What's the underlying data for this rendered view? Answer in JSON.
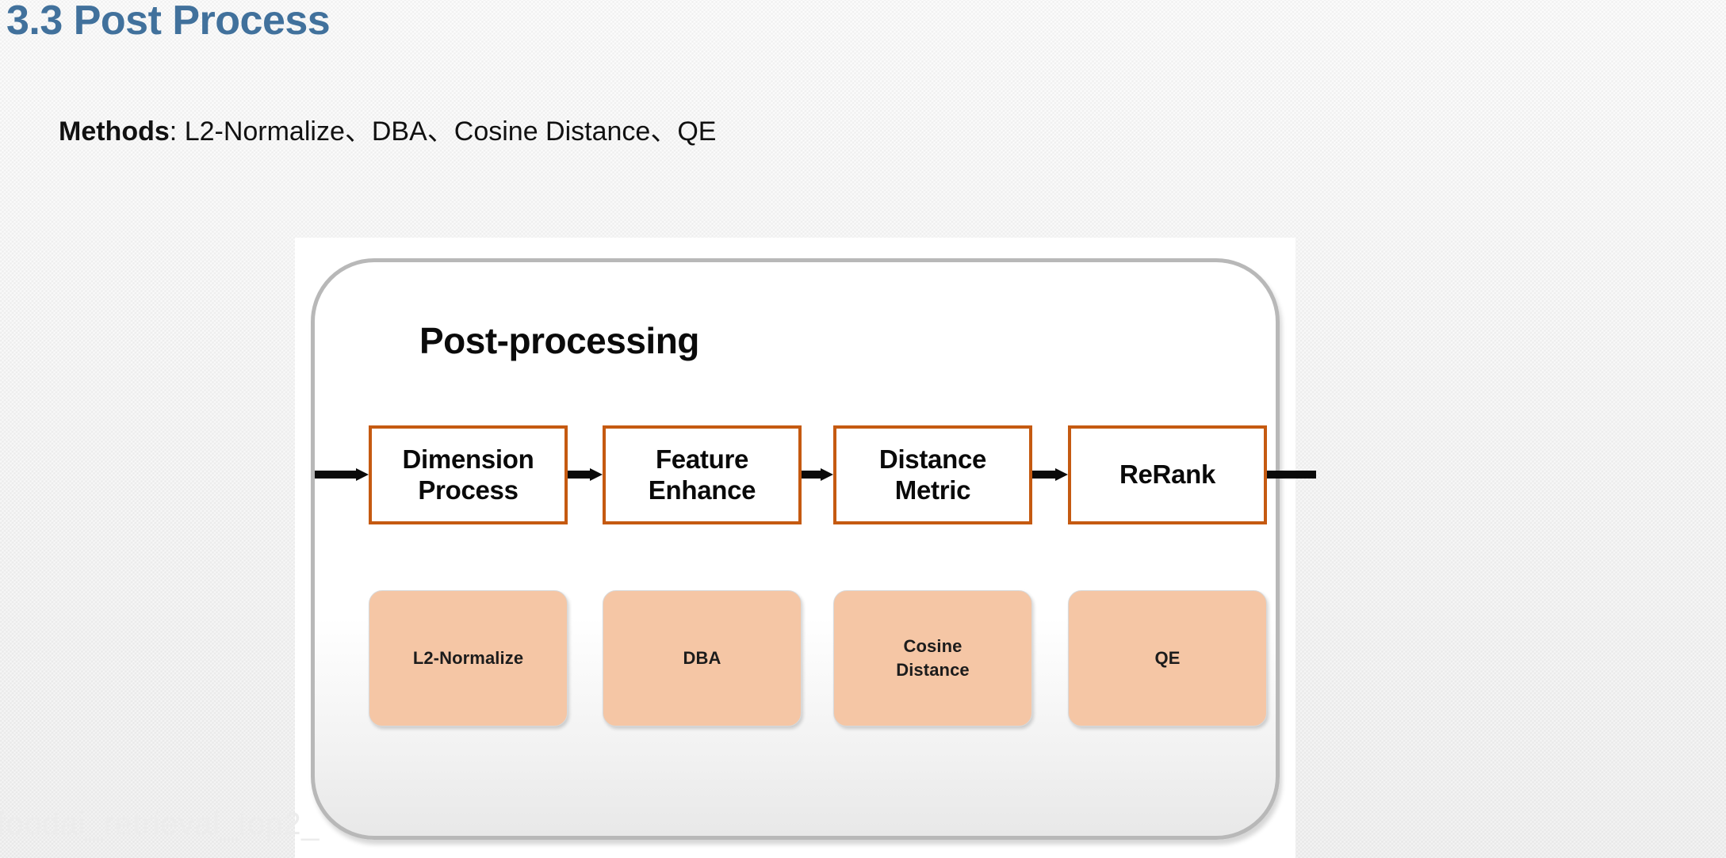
{
  "slide": {
    "title": "3.3 Post Process",
    "title_color": "#41719C",
    "background_color": "#fafafa",
    "watermark": "foodai_retrieval_top2_"
  },
  "methods_line": {
    "label": "Methods",
    "separator": ": ",
    "value": "L2-Normalize、DBA、Cosine Distance、QE"
  },
  "figure": {
    "heading": "Post-processing",
    "panel_border_color": "#b8b8b8",
    "stage_border_color": "#C55A11",
    "method_fill_color": "#F5C6A5",
    "stages": [
      {
        "line1": "Dimension",
        "line2": "Process"
      },
      {
        "line1": "Feature",
        "line2": "Enhance"
      },
      {
        "line1": "Distance",
        "line2": "Metric"
      },
      {
        "line1": "ReRank",
        "line2": ""
      }
    ],
    "methods": [
      {
        "line1": "L2-Normalize",
        "line2": ""
      },
      {
        "line1": "DBA",
        "line2": ""
      },
      {
        "line1": "Cosine",
        "line2": "Distance"
      },
      {
        "line1": "QE",
        "line2": ""
      }
    ],
    "arrows": {
      "input": "arrow-right",
      "between_1_2": "arrow-right",
      "between_2_3": "arrow-right",
      "between_3_4": "arrow-right",
      "output": "line-right"
    }
  }
}
